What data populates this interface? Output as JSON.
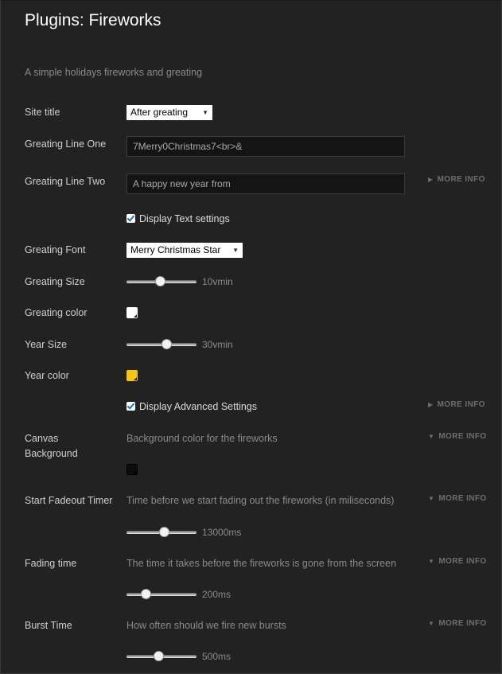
{
  "header": {
    "title": "Plugins: Fireworks",
    "description": "A simple holidays fireworks and greating"
  },
  "site_title": {
    "label": "Site title",
    "value": "After greating"
  },
  "line_one": {
    "label": "Greating Line One",
    "value": "7Merry0Christmas7<br>&"
  },
  "line_two": {
    "label": "Greating Line Two",
    "placeholder": "A happy new year from",
    "more_info": "MORE INFO"
  },
  "display_text": {
    "label": "Display Text settings",
    "checked": true
  },
  "font": {
    "label": "Greating Font",
    "value": "Merry Christmas Star"
  },
  "size": {
    "label": "Greating Size",
    "value_text": "10vmin",
    "level": 0.48
  },
  "greeting_color": {
    "label": "Greating color",
    "color": "#ffffff"
  },
  "year_size": {
    "label": "Year Size",
    "value_text": "30vmin",
    "level": 0.57
  },
  "year_color": {
    "label": "Year color",
    "color": "#f5c518"
  },
  "display_advanced": {
    "label": "Display Advanced Settings",
    "checked": true,
    "more_info": "MORE INFO"
  },
  "canvas_bg": {
    "label": "Canvas Background",
    "hint": "Background color for the fireworks",
    "color": "#0d0d0d",
    "more_info": "MORE INFO"
  },
  "fadeout": {
    "label": "Start Fadeout Timer",
    "hint": "Time before we start fading out the fireworks (in miliseconds)",
    "value_text": "13000ms",
    "level": 0.53,
    "more_info": "MORE INFO"
  },
  "fading": {
    "label": "Fading time",
    "hint": "The time it takes before the fireworks is gone from the screen",
    "value_text": "200ms",
    "level": 0.27,
    "more_info": "MORE INFO"
  },
  "burst": {
    "label": "Burst Time",
    "hint": "How often should we fire new bursts",
    "value_text": "500ms",
    "level": 0.45,
    "more_info": "MORE INFO"
  }
}
